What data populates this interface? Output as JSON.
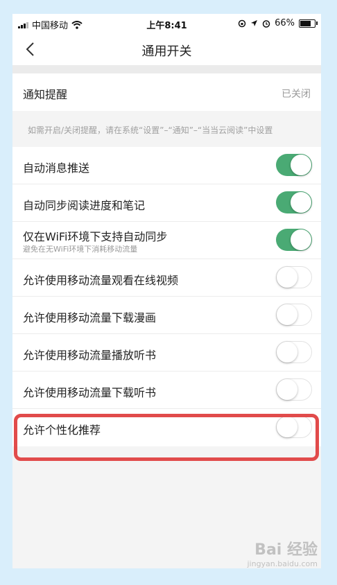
{
  "status_bar": {
    "carrier": "中国移动",
    "time": "上午8:41",
    "battery": "66%"
  },
  "nav": {
    "title": "通用开关",
    "back_icon": "chevron-left-icon"
  },
  "notification": {
    "label": "通知提醒",
    "value": "已关闭",
    "hint": "如需开启/关闭提醒，请在系统“设置”–“通知”–“当当云阅读”中设置"
  },
  "settings": [
    {
      "label": "自动消息推送",
      "sub": "",
      "on": true
    },
    {
      "label": "自动同步阅读进度和笔记",
      "sub": "",
      "on": true
    },
    {
      "label": "仅在WiFi环境下支持自动同步",
      "sub": "避免在无WiFi环境下消耗移动流量",
      "on": true
    },
    {
      "label": "允许使用移动流量观看在线视频",
      "sub": "",
      "on": false
    },
    {
      "label": "允许使用移动流量下载漫画",
      "sub": "",
      "on": false
    },
    {
      "label": "允许使用移动流量播放听书",
      "sub": "",
      "on": false
    },
    {
      "label": "允许使用移动流量下载听书",
      "sub": "",
      "on": false
    },
    {
      "label": "允许个性化推荐",
      "sub": "",
      "on": false
    }
  ],
  "watermark": {
    "text": "Bai 经验",
    "url": "jingyan.baidu.com"
  },
  "colors": {
    "toggle_on": "#4aaa74",
    "highlight": "#e14b4b"
  }
}
